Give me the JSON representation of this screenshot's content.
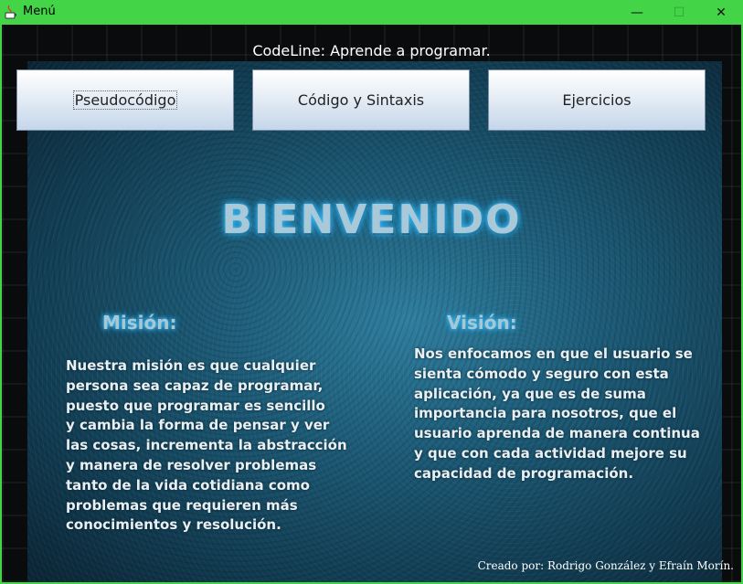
{
  "window": {
    "title": "Menú",
    "controls": {
      "minimize": "—",
      "maximize": "☐",
      "close": "✕"
    }
  },
  "header": {
    "app_title": "CodeLine: Aprende a programar."
  },
  "nav": {
    "buttons": [
      {
        "label": "Pseudocódigo"
      },
      {
        "label": "Código y Sintaxis"
      },
      {
        "label": "Ejercicios"
      }
    ]
  },
  "main": {
    "welcome": "BIENVENIDO",
    "mision": {
      "heading": "Misión:",
      "text": "Nuestra misión es que cualquier\npersona sea capaz de programar,\npuesto que programar es sencillo\ny cambia la forma de pensar y ver\nlas cosas, incrementa la abstracción\ny manera de resolver problemas\ntanto de la vida cotidiana como\nproblemas que requieren más\nconocimientos y resolución."
    },
    "vision": {
      "heading": "Visión:",
      "text": "Nos enfocamos en que el usuario se\nsienta cómodo y seguro con esta\naplicación, ya que es de suma\nimportancia para nosotros, que el\nusuario aprenda de manera continua\ny que con cada actividad mejore su\ncapacidad de programación."
    }
  },
  "footer": {
    "credits": "Creado por: Rodrigo González y Efraín Morín."
  },
  "colors": {
    "titlebar": "#43d447",
    "panel_blue": "#1d5c78",
    "glow": "#47c4ff"
  }
}
